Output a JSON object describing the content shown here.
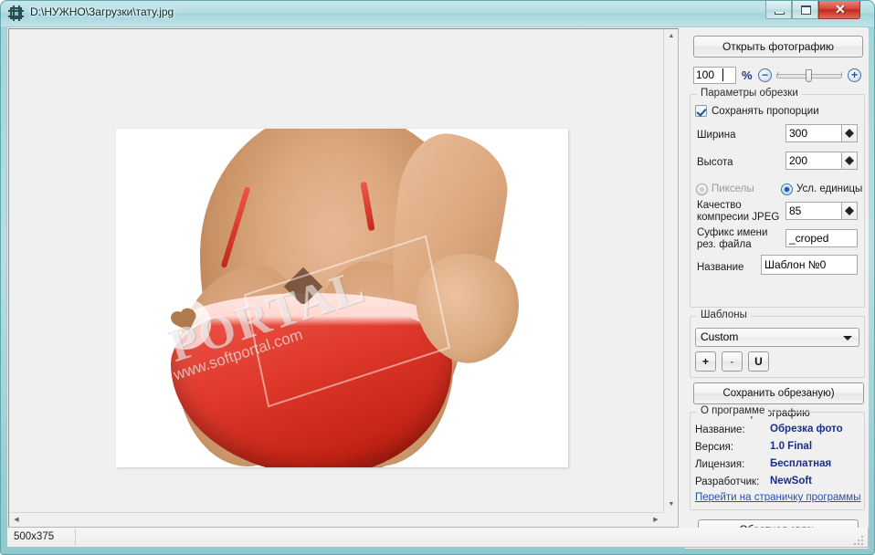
{
  "window": {
    "title": "D:\\НУЖНО\\Загрузки\\тату.jpg",
    "icon": "crop-app-icon",
    "buttons": {
      "minimize": "minimize-icon",
      "maximize": "maximize-icon",
      "close_glyph": "✕"
    }
  },
  "viewer": {
    "image_name": "тату.jpg",
    "watermark": {
      "text": "PORTAL",
      "url": "www.softportal.com",
      "badge": "heart-badge-icon"
    },
    "scroll": {
      "up_arrow": "▲",
      "down_arrow": "▼",
      "left_arrow": "◀",
      "right_arrow": "▶"
    }
  },
  "panel": {
    "open_button": "Открыть фотографию",
    "zoom": {
      "value": "100",
      "percent_label": "%",
      "minus": "−",
      "plus": "+",
      "slider_position_pct": 45
    },
    "crop_group": {
      "legend": "Параметры обрезки",
      "keep_ratio_label": "Сохранять пропорции",
      "keep_ratio_checked": true,
      "width_label": "Ширина",
      "width_value": "300",
      "height_label": "Высота",
      "height_value": "200",
      "unit_pixels_label": "Пикселы",
      "unit_relative_label": "Усл. единицы",
      "unit_selected": "Усл. единицы",
      "jpeg_quality_label_1": "Качество",
      "jpeg_quality_label_2": "компресии JPEG",
      "jpeg_quality_value": "85",
      "suffix_label_1": "Суфикс имени",
      "suffix_label_2": "рез. файла",
      "suffix_value": "_croped",
      "name_label": "Название",
      "name_value": "Шаблон №0"
    },
    "templates_group": {
      "legend": "Шаблоны",
      "selected": "Custom",
      "add_button": "+",
      "remove_button": "-",
      "update_button": "U"
    },
    "save_button": "Сохранить обрезаную) фотографию",
    "about_group": {
      "legend": "О программе",
      "rows": [
        {
          "label": "Название:",
          "value": "Обрезка фото"
        },
        {
          "label": "Версия:",
          "value": "1.0 Final"
        },
        {
          "label": "Лицензия:",
          "value": "Бесплатная"
        },
        {
          "label": "Разработчик:",
          "value": "NewSoft"
        }
      ],
      "link": "Перейти на страничку программы"
    },
    "feedback_button": "Обратная связь"
  },
  "statusbar": {
    "dimensions": "500x375"
  },
  "colors": {
    "frame": "#9fd4d8",
    "close": "#d9483c",
    "accent_text": "#1a2f8c",
    "link": "#2a4fb5",
    "photo_red": "#e03a2c"
  }
}
